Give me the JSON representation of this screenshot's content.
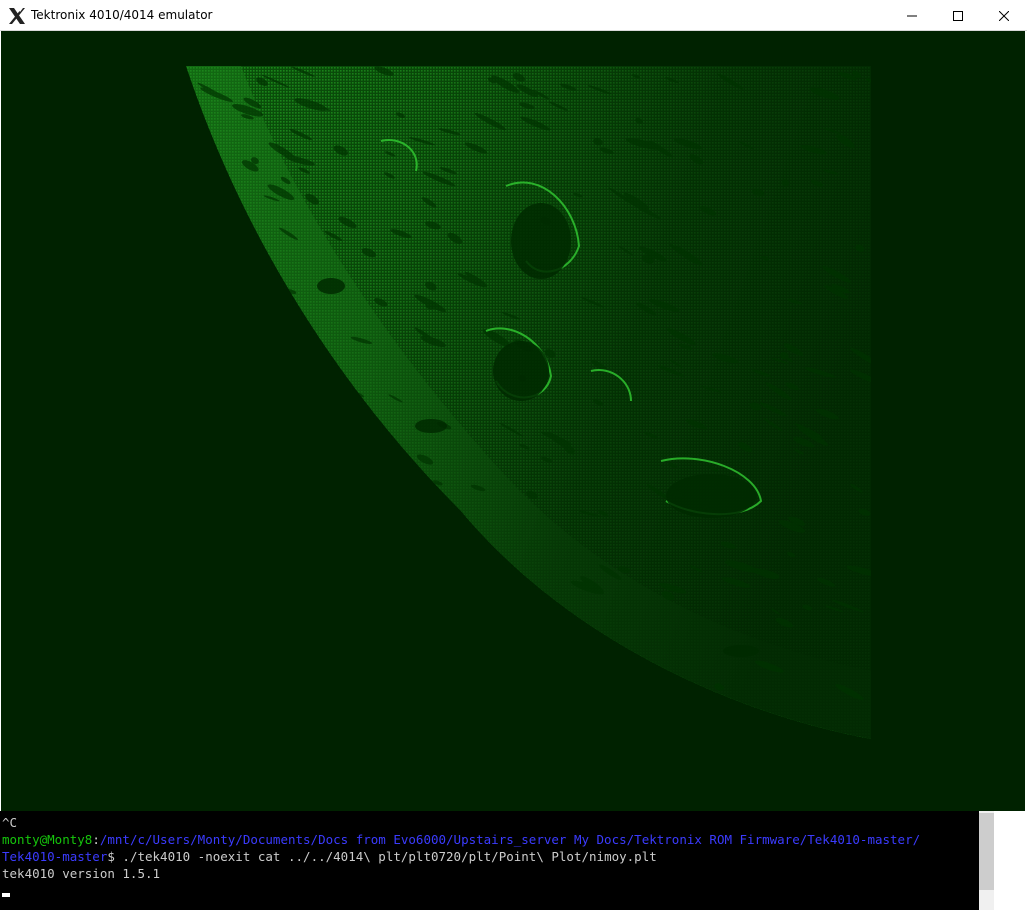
{
  "window": {
    "title": "Tektronix 4010/4014 emulator",
    "app_icon": "x-logo-icon",
    "controls": {
      "minimize": "minimize-icon",
      "maximize": "maximize-icon",
      "close": "close-icon"
    }
  },
  "display": {
    "content": "moon-crater-plot",
    "background_color": "#002200",
    "phosphor_color": "#22cc22"
  },
  "terminal": {
    "interrupt": "^C",
    "prompt_user": "monty@Monty8",
    "prompt_sep": ":",
    "prompt_path_1": "/mnt/c/Users/Monty/Documents/Docs from Evo6000/Upstairs_server My Docs/Tektronix ROM Firmware/Tek4010-master/",
    "prompt_path_2": "Tek4010-master",
    "prompt_symbol": "$ ",
    "command": "./tek4010 -noexit cat ../../4014\\ plt/plt0720/plt/Point\\ Plot/nimoy.plt",
    "output": "tek4010 version 1.5.1"
  }
}
